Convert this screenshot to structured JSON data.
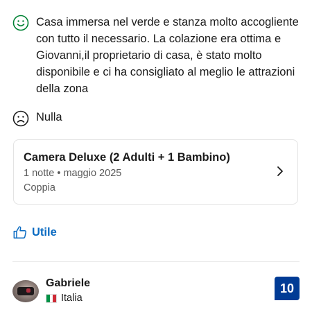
{
  "review": {
    "positive": {
      "icon": "smiley-happy-icon",
      "text": "Casa immersa nel verde e stanza molto accogliente con tutto il necessario. La colazione era ottima e Giovanni,il proprietario di casa, è stato molto disponibile e ci ha consigliato al meglio le attrazioni della zona"
    },
    "negative": {
      "icon": "smiley-sad-icon",
      "text": "Nulla"
    }
  },
  "stay": {
    "room": "Camera Deluxe (2 Adulti + 1 Bambino)",
    "details": "1 notte • maggio 2025",
    "traveler_type": "Coppia"
  },
  "helpful": {
    "label": "Utile"
  },
  "reviewer": {
    "name": "Gabriele",
    "country": "Italia",
    "score": "10"
  },
  "colors": {
    "positive_icon": "#008234",
    "link_blue": "#0a6bc2",
    "score_bg": "#003b95",
    "flag_green": "#009246",
    "flag_white": "#ffffff",
    "flag_red": "#ce2b37"
  }
}
